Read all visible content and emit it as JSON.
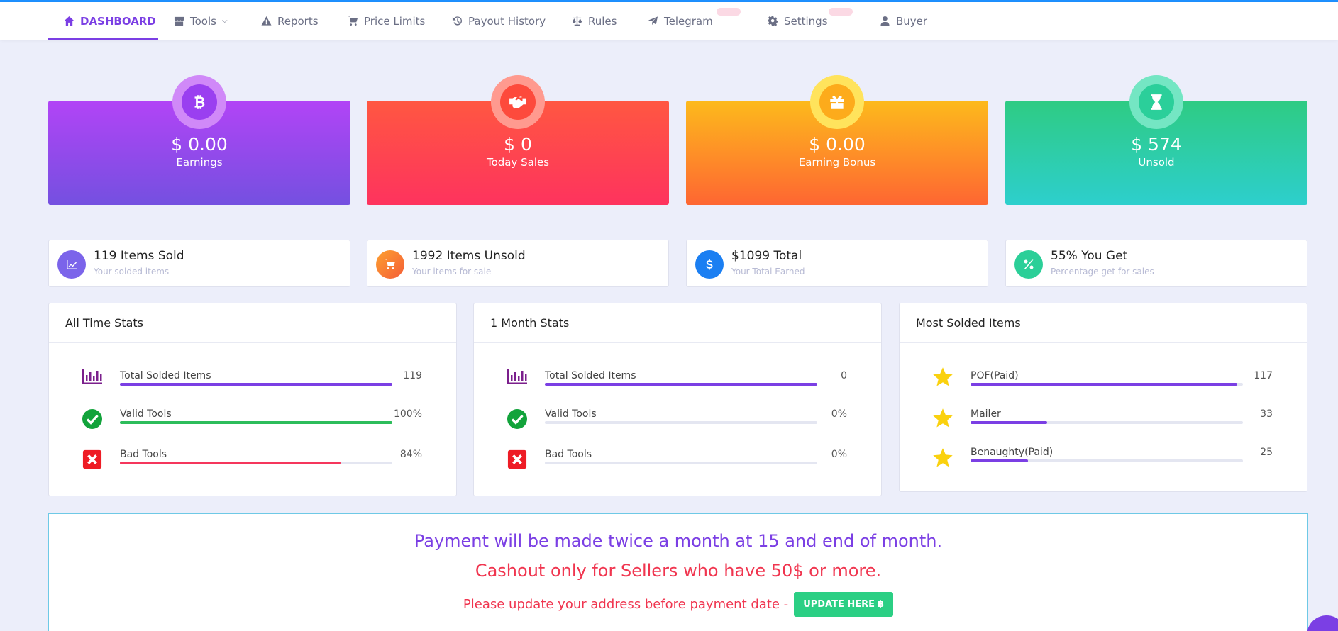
{
  "nav": {
    "items": [
      {
        "label": "DASHBOARD",
        "icon": "home-icon"
      },
      {
        "label": "Tools",
        "icon": "store-icon"
      },
      {
        "label": "Reports",
        "icon": "warning-icon"
      },
      {
        "label": "Price Limits",
        "icon": "cart-icon"
      },
      {
        "label": "Payout History",
        "icon": "history-icon"
      },
      {
        "label": "Rules",
        "icon": "balance-scale-icon"
      },
      {
        "label": "Telegram",
        "icon": "telegram-icon"
      },
      {
        "label": "Settings",
        "icon": "gear-icon"
      },
      {
        "label": "Buyer",
        "icon": "user-icon"
      }
    ],
    "active": "DASHBOARD"
  },
  "cards": [
    {
      "value": "$ 0.00",
      "label": "Earnings",
      "icon": "bitcoin-icon"
    },
    {
      "value": "$ 0",
      "label": "Today Sales",
      "icon": "handshake-icon"
    },
    {
      "value": "$ 0.00",
      "label": "Earning Bonus",
      "icon": "gift-icon"
    },
    {
      "value": "$ 574",
      "label": "Unsold",
      "icon": "hourglass-icon"
    }
  ],
  "info": [
    {
      "number": "119",
      "text": " Items Sold",
      "sub": "Your solded items",
      "icon": "chart-icon"
    },
    {
      "number": "1992",
      "text": " Items Unsold",
      "sub": "Your items for sale",
      "icon": "cart-icon"
    },
    {
      "number": "$1099",
      "text": " Total",
      "sub": "Your Total Earned",
      "icon": "dollar-icon"
    },
    {
      "number": "55%",
      "text": " You Get",
      "sub": "Percentage get for sales",
      "icon": "percent-icon"
    }
  ],
  "all_time": {
    "title": "All Time Stats",
    "rows": [
      {
        "name": "Total Solded Items",
        "value": "119",
        "level": 1.0,
        "color": "#7b3fe4",
        "icon": "bar-chart-icon"
      },
      {
        "name": "Valid Tools",
        "value": "100%",
        "level": 1.0,
        "color": "#2dbd5b",
        "icon": "check-circle-icon"
      },
      {
        "name": "Bad Tools",
        "value": "84%",
        "level": 0.81,
        "color": "#f5365c",
        "icon": "close-box-icon"
      }
    ]
  },
  "one_month": {
    "title": "1 Month Stats",
    "rows": [
      {
        "name": "Total Solded Items",
        "value": "0",
        "level": 1.0,
        "color": "#7b3fe4",
        "icon": "bar-chart-icon"
      },
      {
        "name": "Valid Tools",
        "value": "0%",
        "level": 0.0,
        "color": "#2dbd5b",
        "icon": "check-circle-icon"
      },
      {
        "name": "Bad Tools",
        "value": "0%",
        "level": 0.0,
        "color": "#f5365c",
        "icon": "close-box-icon"
      }
    ]
  },
  "most_solded": {
    "title": "Most Solded Items",
    "rows": [
      {
        "name": "POF(Paid)",
        "value": "117",
        "level": 0.98,
        "color": "#7b3fe4",
        "icon": "star-icon"
      },
      {
        "name": "Mailer",
        "value": "33",
        "level": 0.28,
        "color": "#7b3fe4",
        "icon": "star-icon"
      },
      {
        "name": "Benaughty(Paid)",
        "value": "25",
        "level": 0.21,
        "color": "#7b3fe4",
        "icon": "star-icon"
      }
    ]
  },
  "payment": {
    "line1": "Payment will be made twice a month at 15 and end of month.",
    "line2": "Cashout only for Sellers who have 50$ or more.",
    "line3": "Please update your address before payment date -",
    "button": "UPDATE HERE"
  }
}
